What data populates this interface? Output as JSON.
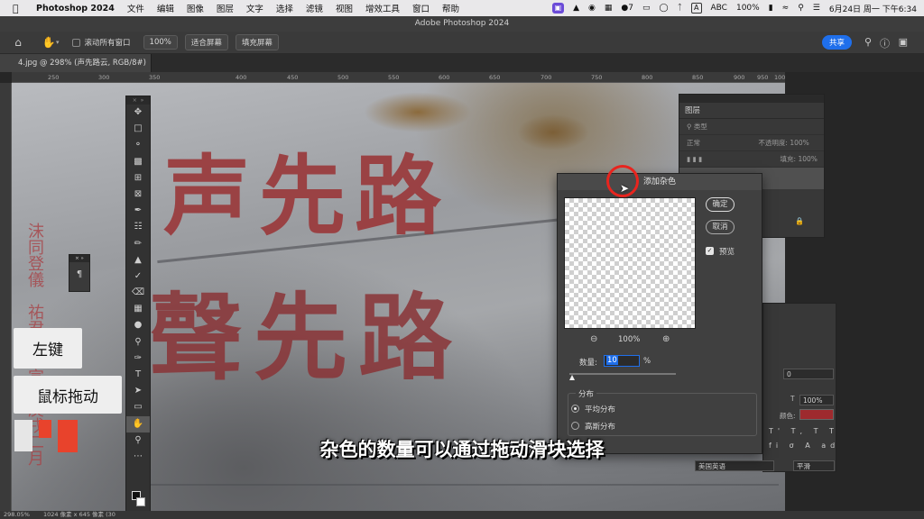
{
  "menubar": {
    "app": "Photoshop 2024",
    "items": [
      "文件",
      "编辑",
      "图像",
      "图层",
      "文字",
      "选择",
      "滤镜",
      "视图",
      "增效工具",
      "窗口",
      "帮助"
    ],
    "wechat_count": "7",
    "input_method": "ABC",
    "battery": "100%",
    "datetime": "6月24日 周一 下午6:34"
  },
  "window": {
    "title": "Adobe Photoshop 2024"
  },
  "options": {
    "scroll_all": "滚动所有窗口",
    "zoom_value": "100%",
    "fit_screen": "适合屏幕",
    "fill_screen": "填充屏幕",
    "share": "共享"
  },
  "document_tab": {
    "label": "4.jpg @ 298% (声先路云, RGB/8#) *"
  },
  "ruler": {
    "ticks": [
      "250",
      "300",
      "350",
      "400",
      "450",
      "500",
      "550",
      "600",
      "650",
      "700",
      "750",
      "800",
      "850",
      "900",
      "950",
      "1000"
    ]
  },
  "canvas": {
    "line1": "声先路",
    "line2": "聲先路",
    "small_text": "沫同登儀　祐君祖　宣統庚戌二月"
  },
  "overlay": {
    "left_click": "左键",
    "mouse_drag": "鼠标拖动",
    "subtitle": "杂色的数量可以通过拖动滑块选择",
    "accent": "#e8432c"
  },
  "layers_panel": {
    "title": "图层",
    "search": "类型",
    "blend_mode": "正常",
    "opacity_label": "不透明度:",
    "opacity_value": "100%",
    "fill_label": "填充:",
    "fill_value": "100%"
  },
  "char_panel": {
    "tracking_value": "0",
    "scale_value": "100%",
    "color_label": "颜色:",
    "text_color": "#9e2a2e",
    "language": "美国英语",
    "antialias": "平滑"
  },
  "dialog": {
    "title": "添加杂色",
    "ok": "确定",
    "cancel": "取消",
    "preview": "预览",
    "zoom": "100%",
    "amount_label": "数量:",
    "amount_value": "10",
    "amount_unit": "%",
    "amount_fraction": 0.025,
    "distribution_label": "分布",
    "uniform": "平均分布",
    "gaussian": "高斯分布"
  },
  "status": {
    "zoom": "298.05%",
    "size": "1024 像素 x 645 像素 (30"
  }
}
